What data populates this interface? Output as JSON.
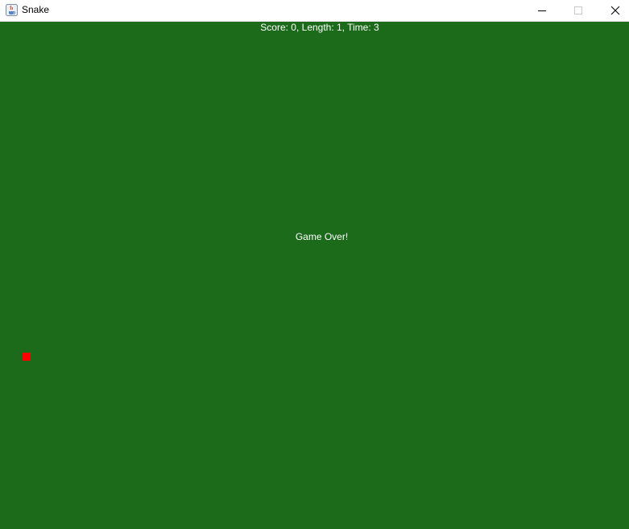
{
  "window": {
    "title": "Snake",
    "app_icon": "java-cup-icon",
    "controls": [
      "minimize-icon",
      "maximize-icon",
      "close-icon"
    ]
  },
  "hud": {
    "text": "Score: 0, Length: 1, Time: 3"
  },
  "game": {
    "message": "Game Over!",
    "background_color": "#1b6b1b",
    "food_color": "#ff0000",
    "text_color": "#ffffff"
  }
}
